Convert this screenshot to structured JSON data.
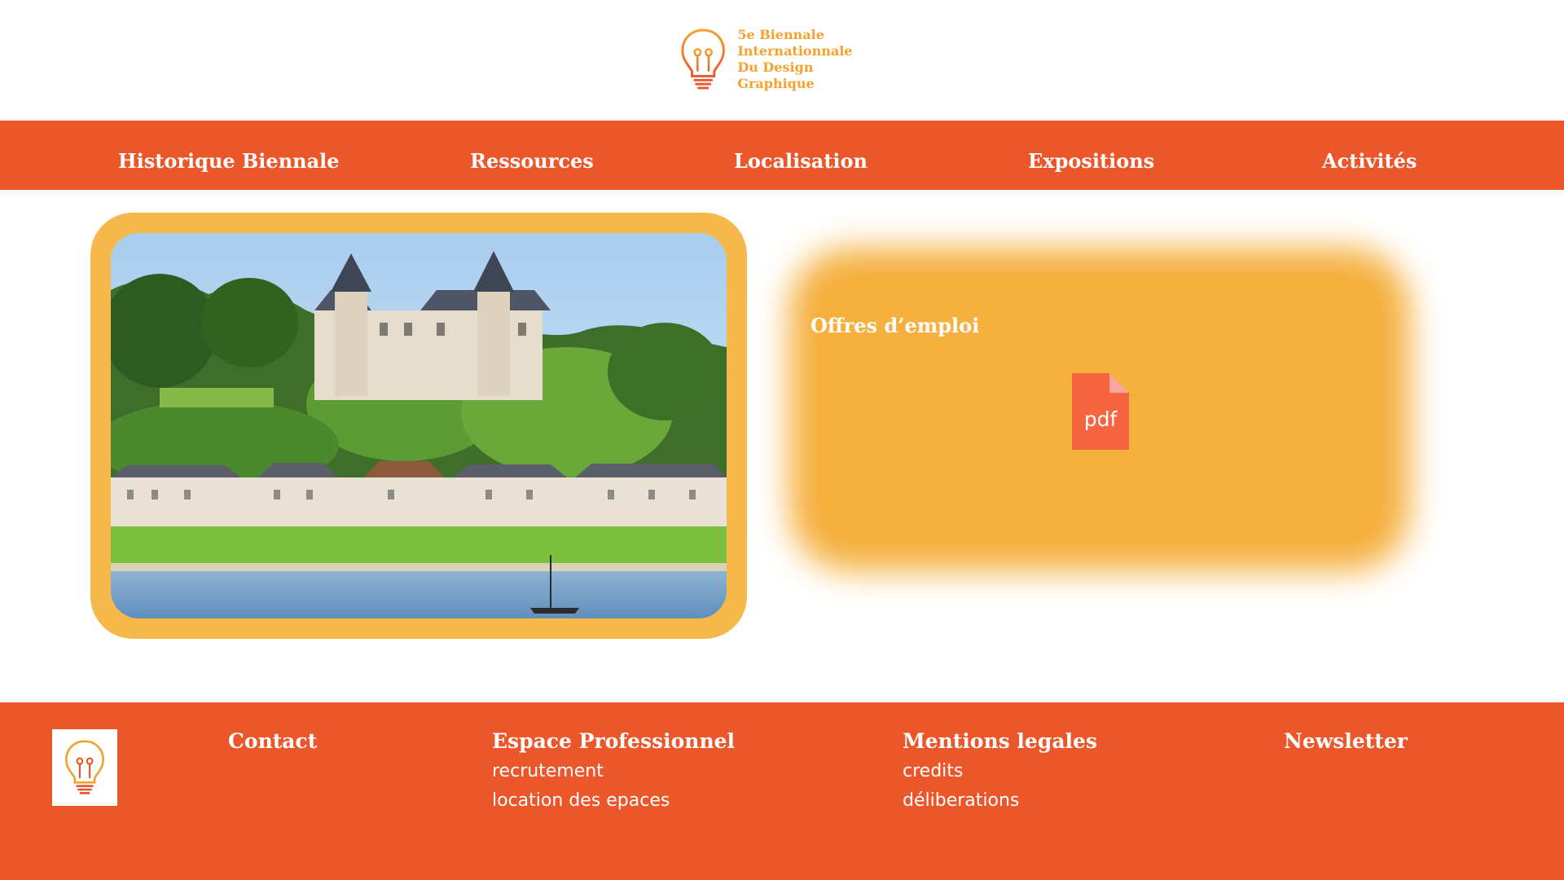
{
  "brand": {
    "logo_icon": "lightbulb-icon",
    "title_line1": "5e Biennale",
    "title_line2": "Internationnale",
    "title_line3": "Du Design Graphique",
    "accent_color": "#eb572a",
    "secondary_color": "#f5b03e"
  },
  "nav": {
    "items": [
      {
        "label": "Historique Biennale"
      },
      {
        "label": "Ressources"
      },
      {
        "label": "Localisation"
      },
      {
        "label": "Expositions"
      },
      {
        "label": "Activités"
      }
    ]
  },
  "main": {
    "photo_icon": "chateau-landscape-image",
    "offers": {
      "title": "Offres d’emploi",
      "file_label": "pdf",
      "file_icon": "pdf-file-icon"
    }
  },
  "footer": {
    "contact": "Contact",
    "pro": {
      "title": "Espace Professionnel",
      "links": [
        "recrutement",
        "location des epaces"
      ]
    },
    "legal": {
      "title": "Mentions legales",
      "links": [
        "credits",
        "déliberations"
      ]
    },
    "newsletter": "Newsletter"
  }
}
